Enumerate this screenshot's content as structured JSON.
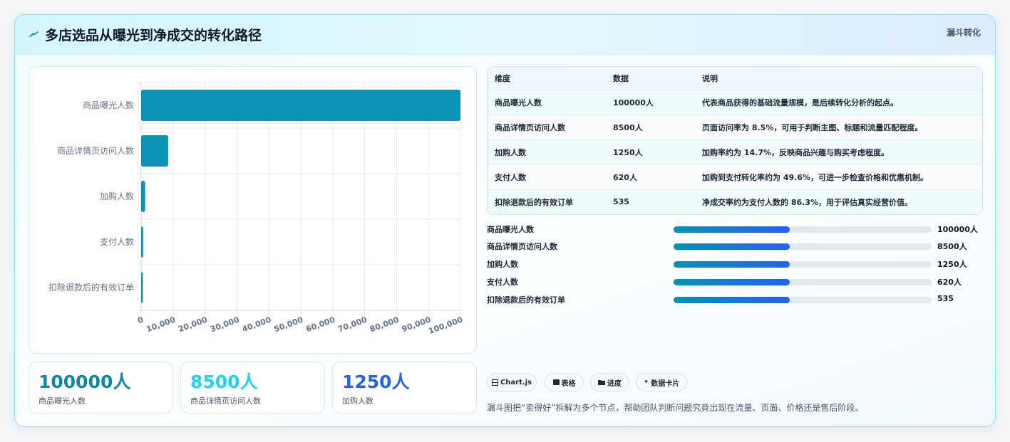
{
  "header": {
    "title": "多店选品从曝光到净成交的转化路径",
    "tag": "漏斗转化"
  },
  "chart_data": {
    "type": "bar",
    "orientation": "horizontal",
    "categories": [
      "商品曝光人数",
      "商品详情页访问人数",
      "加购人数",
      "支付人数",
      "扣除退款后的有效订单"
    ],
    "values": [
      100000,
      8500,
      1250,
      620,
      535
    ],
    "xlim": [
      0,
      100000
    ],
    "xticks": [
      "0",
      "10,000",
      "20,000",
      "30,000",
      "40,000",
      "50,000",
      "60,000",
      "70,000",
      "80,000",
      "90,000",
      "100,000"
    ],
    "grid": true,
    "legend": "none",
    "color": "#0b93b5"
  },
  "stats": [
    {
      "value": "100000人",
      "label": "商品曝光人数",
      "color": "#0e87a6"
    },
    {
      "value": "8500人",
      "label": "商品详情页访问人数",
      "color": "#22d3ee"
    },
    {
      "value": "1250人",
      "label": "加购人数",
      "color": "#2563eb"
    }
  ],
  "table": {
    "headers": [
      "维度",
      "数据",
      "说明"
    ],
    "rows": [
      [
        "商品曝光人数",
        "100000人",
        "代表商品获得的基础流量规模，是后续转化分析的起点。"
      ],
      [
        "商品详情页访问人数",
        "8500人",
        "页面访问率为 8.5%，可用于判断主图、标题和流量匹配程度。"
      ],
      [
        "加购人数",
        "1250人",
        "加购率约为 14.7%，反映商品兴趣与购买考虑程度。"
      ],
      [
        "支付人数",
        "620人",
        "加购到支付转化率约为 49.6%，可进一步检查价格和优惠机制。"
      ],
      [
        "扣除退款后的有效订单",
        "535",
        "净成交率约为支付人数的 86.3%，用于评估真实经营价值。"
      ]
    ]
  },
  "progress": [
    {
      "label": "商品曝光人数",
      "value": "100000人",
      "fill": 0.45
    },
    {
      "label": "商品详情页访问人数",
      "value": "8500人",
      "fill": 0.45
    },
    {
      "label": "加购人数",
      "value": "1250人",
      "fill": 0.45
    },
    {
      "label": "支付人数",
      "value": "620人",
      "fill": 0.45
    },
    {
      "label": "扣除退款后的有效订单",
      "value": "535",
      "fill": 0.45
    }
  ],
  "pills": [
    {
      "icon": "chart-icon",
      "label": "Chart.js"
    },
    {
      "icon": "table-icon",
      "label": "表格"
    },
    {
      "icon": "folder-icon",
      "label": "进度"
    },
    {
      "icon": "sparkle-icon",
      "label": "数据卡片"
    }
  ],
  "footnote": "漏斗图把“卖得好”拆解为多个节点，帮助团队判断问题究竟出现在流量、页面、价格还是售后阶段。",
  "colors": {
    "accent": "#0b93b5",
    "blue": "#2563eb",
    "cyan": "#22d3ee"
  }
}
